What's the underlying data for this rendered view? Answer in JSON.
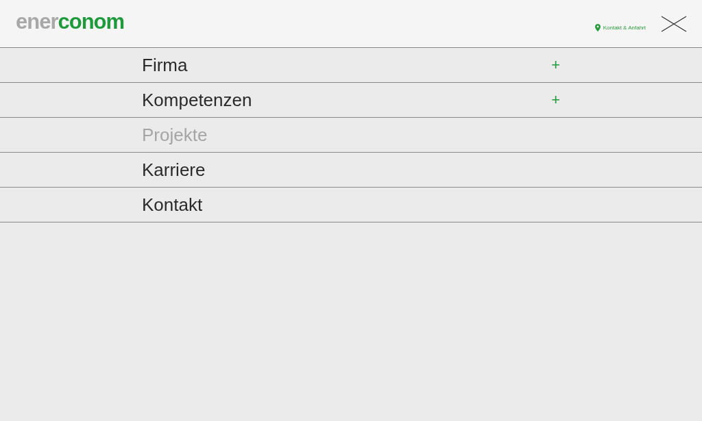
{
  "header": {
    "logo": {
      "part_1": "ener",
      "part_2": "conom"
    },
    "contact_link": "Kontakt & Anfahrt"
  },
  "menu": {
    "items": [
      {
        "label": "Firma",
        "selected": false,
        "toggle": "+"
      },
      {
        "label": "Kompetenzen",
        "selected": false,
        "toggle": "+"
      },
      {
        "label": "Projekte",
        "selected": true
      },
      {
        "label": "Karriere",
        "selected": false
      },
      {
        "label": "Kontakt",
        "selected": false
      }
    ]
  }
}
